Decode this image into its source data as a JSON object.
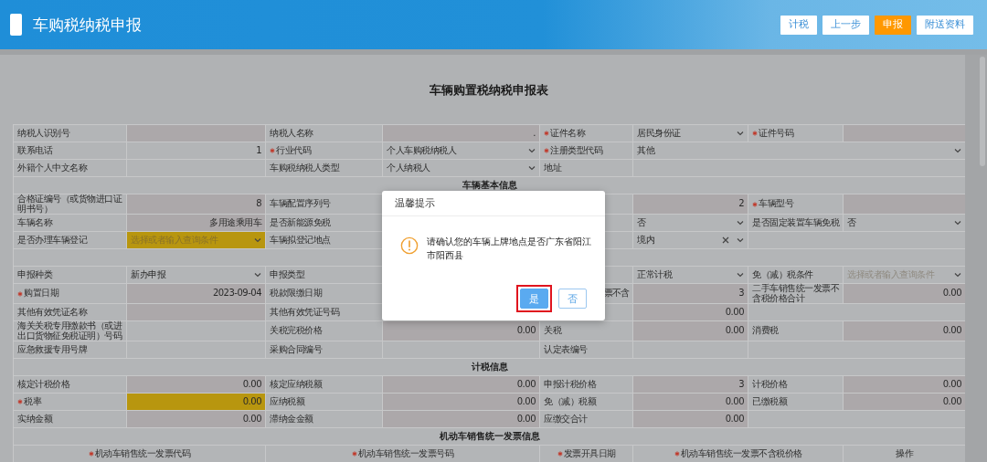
{
  "header": {
    "title": "车购税纳税申报",
    "buttons": [
      {
        "label": "计税",
        "primary": false
      },
      {
        "label": "上一步",
        "primary": false
      },
      {
        "label": "申报",
        "primary": true
      },
      {
        "label": "附送资料",
        "primary": false
      }
    ]
  },
  "form": {
    "title": "车辆购置税纳税申报表",
    "rows": [
      {
        "kind": "fields",
        "cells": [
          {
            "kind": "label",
            "text": "纳税人识别号",
            "required": false
          },
          {
            "kind": "readonly",
            "highlight": false
          },
          {
            "kind": "label",
            "text": "纳税人名称",
            "required": false
          },
          {
            "kind": "readonly",
            "text": ".",
            "highlight": false
          },
          {
            "kind": "label",
            "text": "证件名称",
            "required": true
          },
          {
            "kind": "select",
            "text": "居民身份证",
            "highlight": false,
            "clearable": false
          },
          {
            "kind": "label",
            "text": "证件号码",
            "required": true
          },
          {
            "kind": "readonly",
            "highlight": false
          }
        ]
      },
      {
        "kind": "fields",
        "cells": [
          {
            "kind": "label",
            "text": "联系电话",
            "required": false
          },
          {
            "kind": "input",
            "text": "1",
            "highlight": false
          },
          {
            "kind": "label",
            "text": "行业代码",
            "required": true
          },
          {
            "kind": "select",
            "text": "个人车购税纳税人",
            "highlight": false,
            "clearable": false
          },
          {
            "kind": "label",
            "text": "注册类型代码",
            "required": true
          },
          {
            "kind": "select",
            "text": "其他",
            "highlight": false,
            "clearable": false
          }
        ]
      },
      {
        "kind": "fields",
        "cells": [
          {
            "kind": "label",
            "text": "外籍个人中文名称",
            "required": false
          },
          {
            "kind": "input",
            "highlight": false
          },
          {
            "kind": "label",
            "text": "车购税纳税人类型",
            "required": false
          },
          {
            "kind": "select",
            "text": "个人纳税人",
            "highlight": false,
            "clearable": false
          },
          {
            "kind": "label",
            "text": "地址",
            "required": false
          },
          {
            "kind": "input",
            "highlight": false
          }
        ]
      },
      {
        "kind": "section",
        "title": "车辆基本信息"
      },
      {
        "kind": "fields",
        "cells": [
          {
            "kind": "label",
            "text": "合格证编号（或货物进口证明书号）",
            "required": false
          },
          {
            "kind": "readonly",
            "text": "8",
            "highlight": false
          },
          {
            "kind": "label",
            "text": "车辆配置序列号",
            "required": false
          },
          {
            "kind": "covered"
          },
          {
            "kind": "covered"
          },
          {
            "kind": "readonly",
            "text": "2",
            "highlight": false
          },
          {
            "kind": "label",
            "text": "车辆型号",
            "required": true
          },
          {
            "kind": "readonly",
            "highlight": false
          }
        ]
      },
      {
        "kind": "fields",
        "cells": [
          {
            "kind": "label",
            "text": "车辆名称",
            "required": false
          },
          {
            "kind": "readonly",
            "text": "多用途乘用车",
            "highlight": false
          },
          {
            "kind": "label",
            "text": "是否新能源免税",
            "required": false
          },
          {
            "kind": "covered"
          },
          {
            "kind": "covered"
          },
          {
            "kind": "select",
            "text": "否",
            "highlight": false,
            "clearable": false
          },
          {
            "kind": "label",
            "text": "是否固定装置车辆免税",
            "required": false
          },
          {
            "kind": "select",
            "text": "否",
            "highlight": false,
            "clearable": false
          }
        ]
      },
      {
        "kind": "fields",
        "cells": [
          {
            "kind": "label",
            "text": "是否办理车辆登记",
            "required": false
          },
          {
            "kind": "select",
            "placeholder": "选择或者输入查询条件",
            "highlight": true,
            "clearable": false
          },
          {
            "kind": "label",
            "text": "车辆拟登记地点",
            "required": false
          },
          {
            "kind": "covered"
          },
          {
            "kind": "covered"
          },
          {
            "kind": "select",
            "text": "境内",
            "highlight": false,
            "clearable": true
          },
          {
            "kind": "input",
            "highlight": false
          }
        ]
      },
      {
        "kind": "section"
      },
      {
        "kind": "fields",
        "cells": [
          {
            "kind": "label",
            "text": "申报种类",
            "required": false
          },
          {
            "kind": "select",
            "text": "新办申报",
            "highlight": false,
            "clearable": false
          },
          {
            "kind": "label",
            "text": "申报类型",
            "required": false
          },
          {
            "kind": "covered"
          },
          {
            "kind": "covered"
          },
          {
            "kind": "select",
            "text": "正常计税",
            "highlight": false,
            "clearable": false
          },
          {
            "kind": "label",
            "text": "免（减）税条件",
            "required": false
          },
          {
            "kind": "select",
            "placeholder": "选择或者输入查询条件",
            "highlight": false,
            "clearable": false
          }
        ]
      },
      {
        "kind": "fields",
        "cells": [
          {
            "kind": "label",
            "text": "购置日期",
            "required": true
          },
          {
            "kind": "readonly",
            "text": "2023-09-04",
            "highlight": false
          },
          {
            "kind": "label",
            "text": "税款限缴日期",
            "required": false
          },
          {
            "kind": "covered"
          },
          {
            "kind": "label_tail",
            "text": "票不含"
          },
          {
            "kind": "readonly",
            "text": "3",
            "highlight": false
          },
          {
            "kind": "label",
            "text": "二手车销售统一发票不含税价格合计",
            "required": false
          },
          {
            "kind": "readonly",
            "text": "0.00",
            "highlight": false
          }
        ]
      },
      {
        "kind": "fields",
        "cells": [
          {
            "kind": "label",
            "text": "其他有效凭证名称",
            "required": false
          },
          {
            "kind": "readonly",
            "highlight": false
          },
          {
            "kind": "label",
            "text": "其他有效凭证号码",
            "required": false
          },
          {
            "kind": "covered"
          },
          {
            "kind": "covered"
          },
          {
            "kind": "readonly",
            "text": "0.00",
            "highlight": false
          },
          {
            "kind": "input",
            "highlight": false
          }
        ]
      },
      {
        "kind": "fields",
        "cells": [
          {
            "kind": "label",
            "text": "海关关税专用缴款书（或进出口货物征免税证明）号码",
            "required": false
          },
          {
            "kind": "input",
            "highlight": false
          },
          {
            "kind": "label",
            "text": "关税完税价格",
            "required": false
          },
          {
            "kind": "readonly",
            "text": "0.00",
            "highlight": false
          },
          {
            "kind": "label",
            "text": "关税",
            "required": false
          },
          {
            "kind": "readonly",
            "text": "0.00",
            "highlight": false
          },
          {
            "kind": "label",
            "text": "消费税",
            "required": false
          },
          {
            "kind": "readonly",
            "text": "0.00",
            "highlight": false
          }
        ]
      },
      {
        "kind": "fields",
        "cells": [
          {
            "kind": "label",
            "text": "应急救援专用号牌",
            "required": false
          },
          {
            "kind": "input",
            "highlight": false
          },
          {
            "kind": "label",
            "text": "采购合同编号",
            "required": false
          },
          {
            "kind": "input",
            "highlight": false
          },
          {
            "kind": "label",
            "text": "认定表编号",
            "required": false
          },
          {
            "kind": "input",
            "highlight": false
          },
          {
            "kind": "input",
            "highlight": false
          }
        ]
      },
      {
        "kind": "section",
        "title": "计税信息"
      },
      {
        "kind": "fields",
        "cells": [
          {
            "kind": "label",
            "text": "核定计税价格",
            "required": false
          },
          {
            "kind": "readonly",
            "text": "0.00",
            "highlight": false
          },
          {
            "kind": "label",
            "text": "核定应纳税额",
            "required": false
          },
          {
            "kind": "readonly",
            "text": "0.00",
            "highlight": false
          },
          {
            "kind": "label",
            "text": "申报计税价格",
            "required": false
          },
          {
            "kind": "readonly",
            "text": "3",
            "highlight": false
          },
          {
            "kind": "label",
            "text": "计税价格",
            "required": false
          },
          {
            "kind": "readonly",
            "text": "0.00",
            "highlight": false
          }
        ]
      },
      {
        "kind": "fields",
        "cells": [
          {
            "kind": "label",
            "text": "税率",
            "required": true
          },
          {
            "kind": "readonly",
            "text": "0.00",
            "highlight": true
          },
          {
            "kind": "label",
            "text": "应纳税额",
            "required": false
          },
          {
            "kind": "readonly",
            "text": "0.00",
            "highlight": false
          },
          {
            "kind": "label",
            "text": "免（减）税额",
            "required": false
          },
          {
            "kind": "readonly",
            "text": "0.00",
            "highlight": false
          },
          {
            "kind": "label",
            "text": "已缴税额",
            "required": false
          },
          {
            "kind": "readonly",
            "text": "0.00",
            "highlight": false
          }
        ]
      },
      {
        "kind": "fields",
        "cells": [
          {
            "kind": "label",
            "text": "实纳金额",
            "required": false
          },
          {
            "kind": "readonly",
            "text": "0.00",
            "highlight": false
          },
          {
            "kind": "label",
            "text": "滞纳金金额",
            "required": false
          },
          {
            "kind": "readonly",
            "text": "0.00",
            "highlight": false
          },
          {
            "kind": "label",
            "text": "应缴交合计",
            "required": false
          },
          {
            "kind": "readonly",
            "text": "0.00",
            "highlight": false
          },
          {
            "kind": "input",
            "highlight": false
          }
        ]
      },
      {
        "kind": "section",
        "title": "机动车销售统一发票信息"
      },
      {
        "kind": "head",
        "cells": [
          {
            "text": "机动车销售统一发票代码",
            "required": true
          },
          {
            "text": "机动车销售统一发票号码",
            "required": true
          },
          {
            "text": "发票开具日期",
            "required": true
          },
          {
            "text": "机动车销售统一发票不含税价格",
            "required": true
          },
          {
            "text": "操作",
            "required": false
          }
        ]
      }
    ]
  },
  "dialog": {
    "title": "温馨提示",
    "message": "请确认您的车辆上牌地点是否广东省阳江市阳西县",
    "buttons": [
      {
        "label": "是",
        "primary": true,
        "highlighted": true
      },
      {
        "label": "否",
        "primary": false,
        "highlighted": false
      }
    ]
  }
}
